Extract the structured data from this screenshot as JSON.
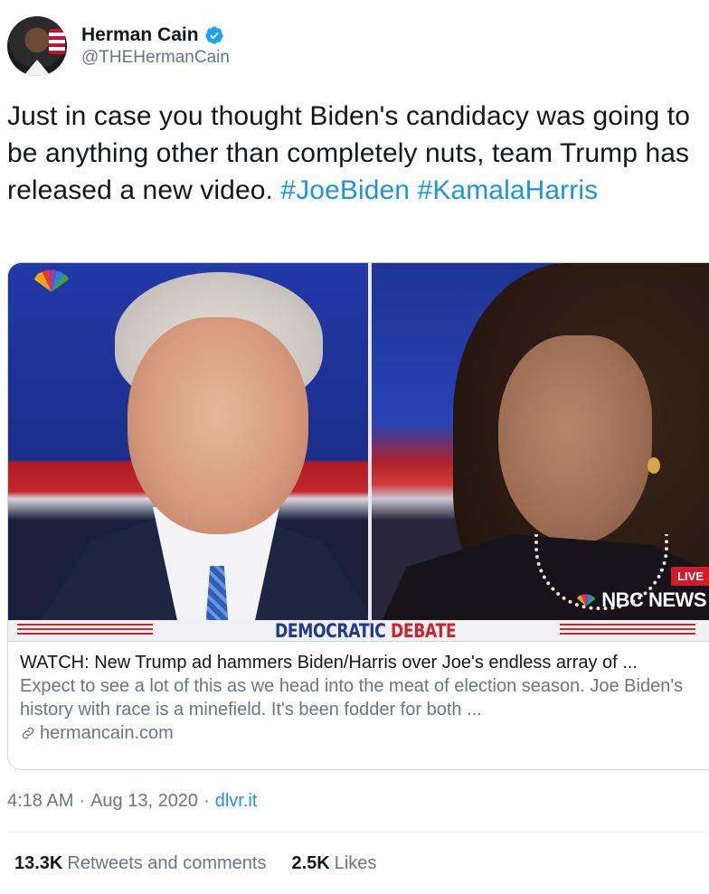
{
  "author": {
    "display_name": "Herman Cain",
    "handle": "@THEHermanCain",
    "verified": true,
    "avatar": "avatar-photo"
  },
  "tweet": {
    "text": "Just in case you thought Biden's candidacy was going to be anything other than completely nuts, team Trump has released a new video.",
    "hashtags": [
      "#JoeBiden",
      "#KamalaHarris"
    ]
  },
  "card": {
    "image_overlay": {
      "live_badge": "LIVE",
      "network_logo": "NBC NEWS",
      "banner_main": "DEMOCRATIC ",
      "banner_accent": "DEBATE",
      "icons": [
        "nbc-peacock-icon"
      ]
    },
    "title": "WATCH: New Trump ad hammers Biden/Harris over Joe's endless array of ...",
    "description": "Expect to see a lot of this as we head into the meat of election season. Joe Biden's history with race is a minefield.  It's been fodder for both ...",
    "domain": "hermancain.com"
  },
  "meta": {
    "time": "4:18 AM",
    "separator1": "·",
    "date": "Aug 13, 2020",
    "separator2": "·",
    "source": "dlvr.it"
  },
  "stats": {
    "retweets_count": "13.3K",
    "retweets_label": "Retweets and comments",
    "likes_count": "2.5K",
    "likes_label": "Likes"
  },
  "colors": {
    "link_blue": "#1b95e0",
    "secondary_text": "#657786",
    "primary_text": "#14171a",
    "border": "#ccd6dd"
  }
}
